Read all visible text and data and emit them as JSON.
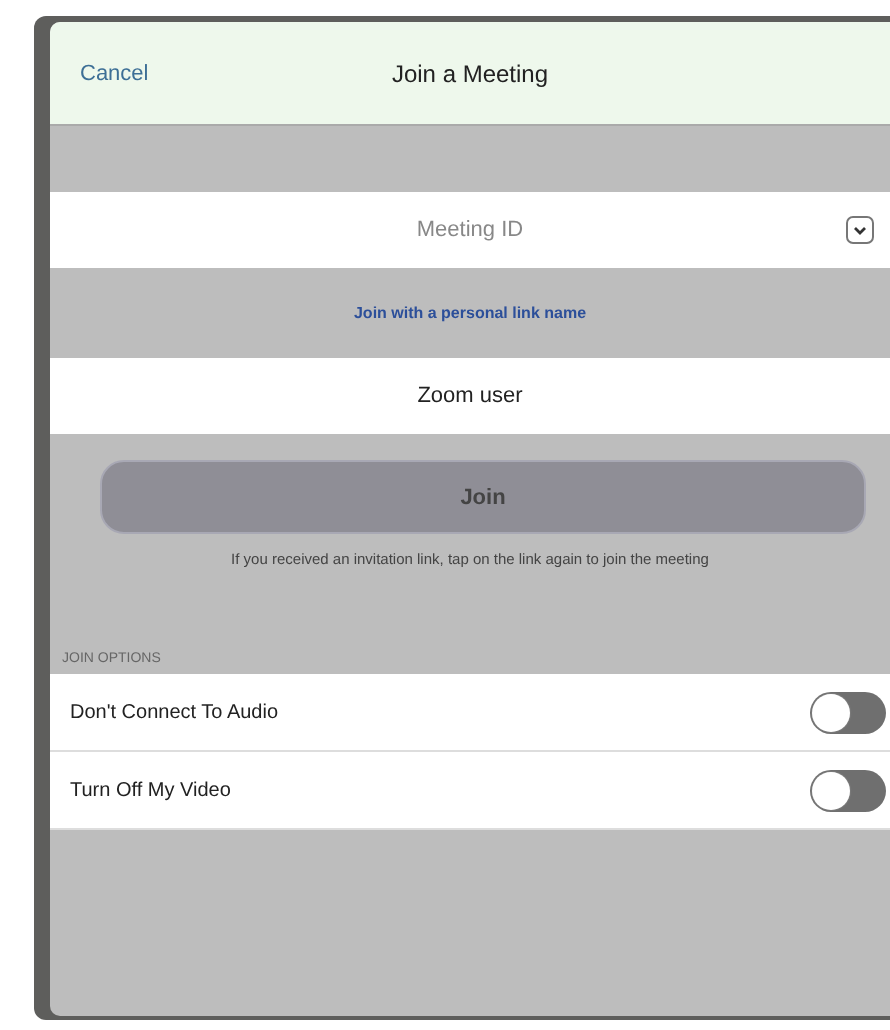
{
  "header": {
    "cancel": "Cancel",
    "title": "Join a Meeting"
  },
  "meeting_id": {
    "placeholder": "Meeting ID"
  },
  "personal_link": "Join with a personal link name",
  "name_field": {
    "value": "Zoom user"
  },
  "join_button": {
    "label": "Join",
    "disabled": true
  },
  "hint": "If you received an invitation link, tap on the link again to join the meeting",
  "options_header": "JOIN OPTIONS",
  "options": [
    {
      "label": "Don't Connect To Audio",
      "on": false
    },
    {
      "label": "Turn Off My Video",
      "on": false
    }
  ]
}
